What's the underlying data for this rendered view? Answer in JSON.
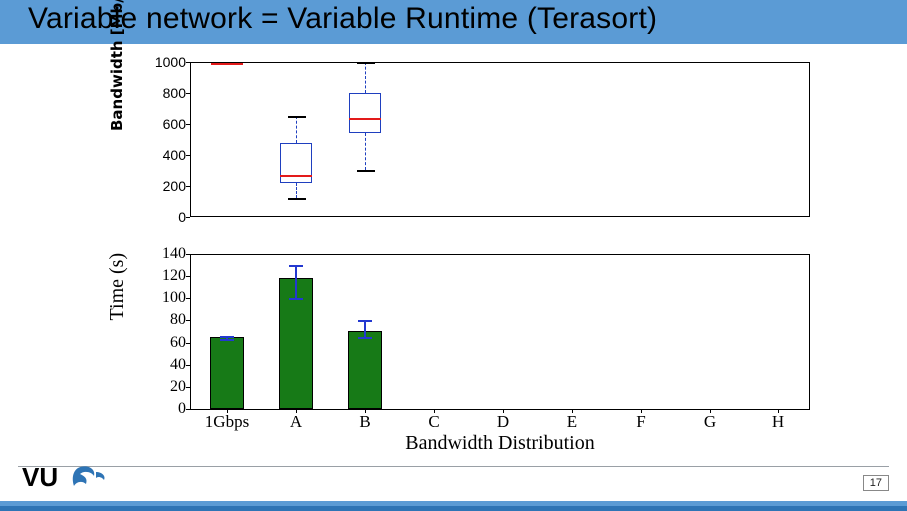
{
  "header": {
    "title": "Variable network = Variable Runtime (Terasort)"
  },
  "footer": {
    "page_number": "17",
    "logo_text": "VU"
  },
  "chart_data": [
    {
      "type": "boxplot",
      "title": "",
      "xlabel": "",
      "ylabel": "Bandwidth [Mb/s]",
      "ylim": [
        0,
        1000
      ],
      "yticks": [
        0,
        200,
        400,
        600,
        800,
        1000
      ],
      "categories": [
        "1Gbps",
        "A",
        "B"
      ],
      "series": [
        {
          "name": "1Gbps",
          "min": 990,
          "q1": 990,
          "median": 995,
          "q3": 1000,
          "max": 1000
        },
        {
          "name": "A",
          "min": 120,
          "q1": 220,
          "median": 270,
          "q3": 370,
          "max": 650
        },
        {
          "name": "B",
          "min": 300,
          "q1": 540,
          "median": 640,
          "q3": 800,
          "max": 1000
        }
      ]
    },
    {
      "type": "bar",
      "title": "",
      "xlabel": "Bandwidth Distribution",
      "ylabel": "Time (s)",
      "ylim": [
        0,
        140
      ],
      "yticks": [
        0,
        20,
        40,
        60,
        80,
        100,
        120,
        140
      ],
      "categories": [
        "1Gbps",
        "A",
        "B",
        "C",
        "D",
        "E",
        "F",
        "G",
        "H"
      ],
      "values": [
        65,
        118,
        70,
        null,
        null,
        null,
        null,
        null,
        null
      ],
      "errors": [
        {
          "low": 63,
          "high": 66
        },
        {
          "low": 100,
          "high": 130
        },
        {
          "low": 65,
          "high": 80
        },
        null,
        null,
        null,
        null,
        null,
        null
      ]
    }
  ]
}
